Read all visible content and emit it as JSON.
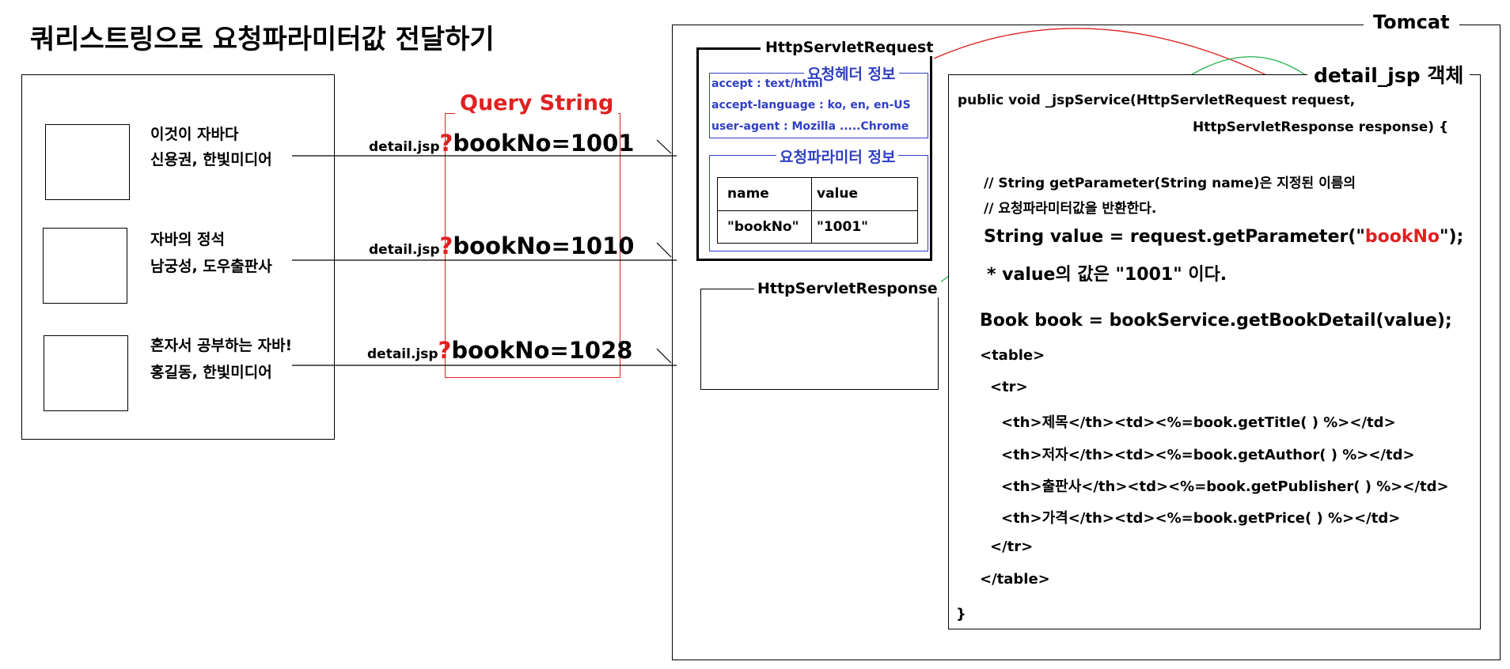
{
  "title": "쿼리스트링으로 요청파라미터값 전달하기",
  "books": [
    {
      "title": "이것이 자바다",
      "author": "신용권, 한빛미디어",
      "link_prefix": "detail.jsp",
      "qmark": "?",
      "query": "bookNo=1001"
    },
    {
      "title": "자바의 정석",
      "author": "남궁성, 도우출판사",
      "link_prefix": "detail.jsp",
      "qmark": "?",
      "query": "bookNo=1010"
    },
    {
      "title": "혼자서 공부하는 자바!",
      "author": "홍길동, 한빛미디어",
      "link_prefix": "detail.jsp",
      "qmark": "?",
      "query": "bookNo=1028"
    }
  ],
  "query_string_label": "Query String",
  "tomcat_label": "Tomcat",
  "request": {
    "label": "HttpServletRequest",
    "header_label": "요청헤더 정보",
    "headers": [
      "accept : text/html",
      "accept-language : ko, en, en-US",
      "user-agent : Mozilla .....Chrome"
    ],
    "param_label": "요청파라미터 정보",
    "param_table": {
      "headers": [
        "name",
        "value"
      ],
      "rows": [
        [
          "\"bookNo\"",
          "\"1001\""
        ]
      ]
    }
  },
  "response": {
    "label": "HttpServletResponse"
  },
  "jsp": {
    "label": "detail_jsp 객체",
    "sig_line1": "public void _jspService(HttpServletRequest request,",
    "sig_line2": "HttpServletResponse response) {",
    "comment1": "// String getParameter(String name)은 지정된 이름의",
    "comment2": "// 요청파라미터값을 반환한다.",
    "code_get_prefix": "String value = request.getParameter(\"",
    "code_get_param": "bookNo",
    "code_get_suffix": "\");",
    "note": "* value의 값은 \"1001\" 이다.",
    "code_book": "Book book = bookService.getBookDetail(value);",
    "html_lines": [
      "<table>",
      "<tr>",
      "<th>제목</th><td><%=book.getTitle( ) %></td>",
      "<th>저자</th><td><%=book.getAuthor( ) %></td>",
      "<th>출판사</th><td><%=book.getPublisher( ) %></td>",
      "<th>가격</th><td><%=book.getPrice( ) %></td>",
      "</tr>",
      "</table>"
    ],
    "close_brace": "}"
  },
  "colors": {
    "red": "#e02020",
    "blue": "#2f3fc4",
    "green": "#22b24c"
  }
}
